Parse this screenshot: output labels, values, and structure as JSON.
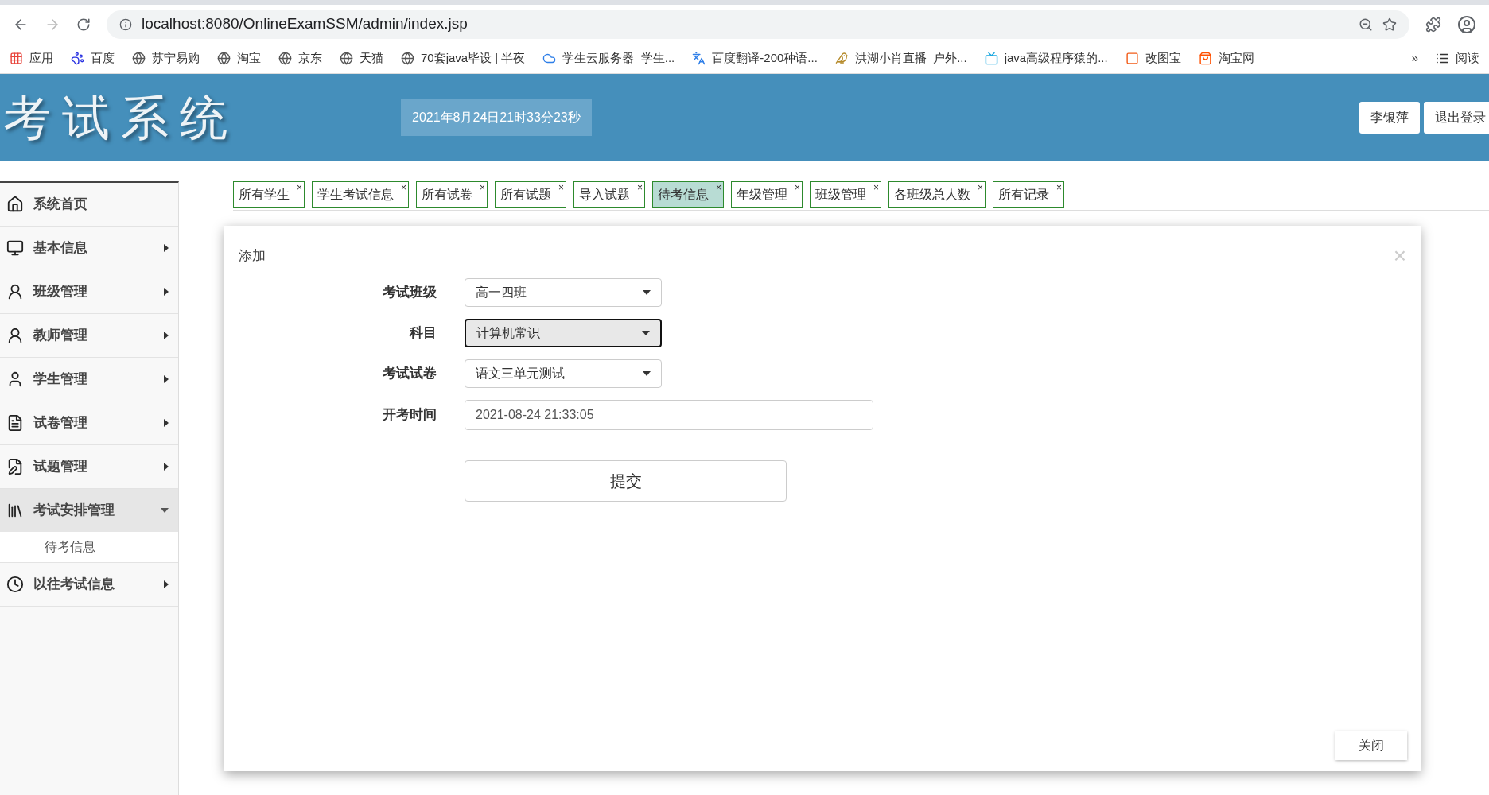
{
  "browser": {
    "url": "localhost:8080/OnlineExamSSM/admin/index.jsp",
    "bookmarks": [
      {
        "label": "应用"
      },
      {
        "label": "百度"
      },
      {
        "label": "苏宁易购"
      },
      {
        "label": "淘宝"
      },
      {
        "label": "京东"
      },
      {
        "label": "天猫"
      },
      {
        "label": "70套java毕设 | 半夜"
      },
      {
        "label": "学生云服务器_学生..."
      },
      {
        "label": "百度翻译-200种语..."
      },
      {
        "label": "洪湖小肖直播_户外..."
      },
      {
        "label": "java高级程序猿的..."
      },
      {
        "label": "改图宝"
      },
      {
        "label": "淘宝网"
      }
    ],
    "overflow": "»",
    "reading_list": "阅读"
  },
  "header": {
    "title": "考试系统",
    "datetime": "2021年8月24日21时33分23秒",
    "user_button": "李银萍",
    "logout_button": "退出登录"
  },
  "sidebar": {
    "items": [
      {
        "label": "系统首页",
        "expanded": false
      },
      {
        "label": "基本信息",
        "expanded": false
      },
      {
        "label": "班级管理",
        "expanded": false
      },
      {
        "label": "教师管理",
        "expanded": false
      },
      {
        "label": "学生管理",
        "expanded": false
      },
      {
        "label": "试卷管理",
        "expanded": false
      },
      {
        "label": "试题管理",
        "expanded": false
      },
      {
        "label": "考试安排管理",
        "expanded": true,
        "children": [
          {
            "label": "待考信息"
          }
        ]
      },
      {
        "label": "以往考试信息",
        "expanded": false
      }
    ]
  },
  "tabs": [
    {
      "label": "所有学生",
      "close": "×",
      "selected": false
    },
    {
      "label": "学生考试信息",
      "close": "×",
      "selected": false
    },
    {
      "label": "所有试卷",
      "close": "×",
      "selected": false
    },
    {
      "label": "所有试题",
      "close": "×",
      "selected": false
    },
    {
      "label": "导入试题",
      "close": "×",
      "selected": false
    },
    {
      "label": "待考信息",
      "close": "×",
      "selected": true
    },
    {
      "label": "年级管理",
      "close": "×",
      "selected": false
    },
    {
      "label": "班级管理",
      "close": "×",
      "selected": false
    },
    {
      "label": "各班级总人数",
      "close": "×",
      "selected": false
    },
    {
      "label": "所有记录",
      "close": "×",
      "selected": false
    }
  ],
  "dialog": {
    "title": "添加",
    "close_glyph": "×",
    "fields": [
      {
        "label": "考试班级",
        "kind": "select",
        "value": "高一四班",
        "focused": false
      },
      {
        "label": "科目",
        "kind": "select",
        "value": "计算机常识",
        "focused": true
      },
      {
        "label": "考试试卷",
        "kind": "select",
        "value": "语文三单元测试",
        "focused": false
      },
      {
        "label": "开考时间",
        "kind": "text",
        "value": "2021-08-24 21:33:05",
        "focused": false
      }
    ],
    "submit_button": "提交",
    "close_button": "关闭"
  }
}
